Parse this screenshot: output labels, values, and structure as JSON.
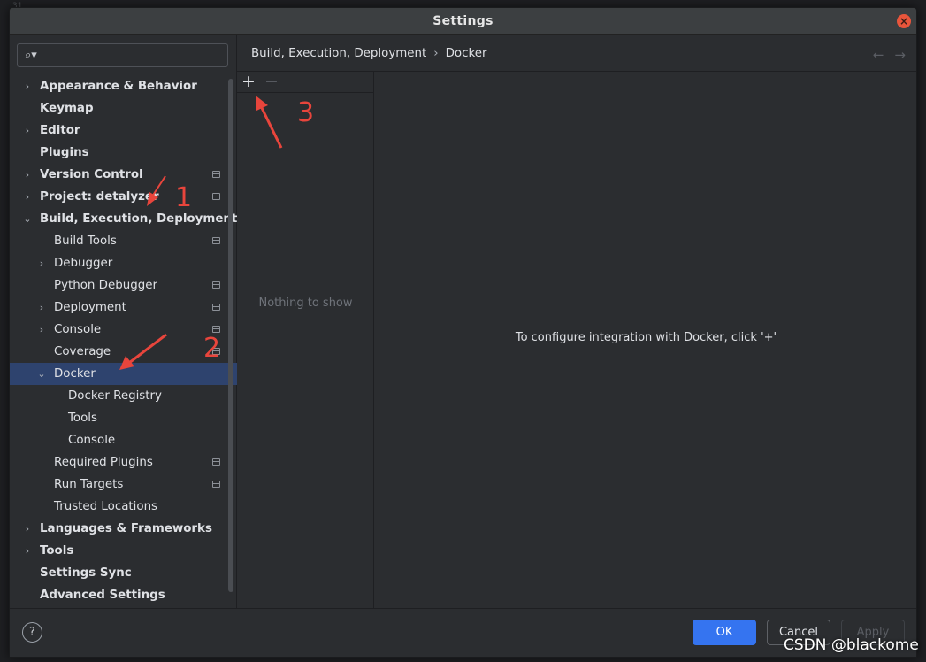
{
  "dialog": {
    "title": "Settings"
  },
  "search": {
    "placeholder": ""
  },
  "tree": [
    {
      "label": "Appearance & Behavior",
      "level": 0,
      "arrow": "›",
      "project_icon": false
    },
    {
      "label": "Keymap",
      "level": 0,
      "arrow": "",
      "project_icon": false
    },
    {
      "label": "Editor",
      "level": 0,
      "arrow": "›",
      "project_icon": false
    },
    {
      "label": "Plugins",
      "level": 0,
      "arrow": "",
      "project_icon": false
    },
    {
      "label": "Version Control",
      "level": 0,
      "arrow": "›",
      "project_icon": true
    },
    {
      "label": "Project: detalyzer",
      "level": 0,
      "arrow": "›",
      "project_icon": true
    },
    {
      "label": "Build, Execution, Deployment",
      "level": 0,
      "arrow": "⌄",
      "project_icon": false
    },
    {
      "label": "Build Tools",
      "level": 1,
      "arrow": "",
      "project_icon": true
    },
    {
      "label": "Debugger",
      "level": 1,
      "arrow": "›",
      "project_icon": false
    },
    {
      "label": "Python Debugger",
      "level": 1,
      "arrow": "",
      "project_icon": true
    },
    {
      "label": "Deployment",
      "level": 1,
      "arrow": "›",
      "project_icon": true
    },
    {
      "label": "Console",
      "level": 1,
      "arrow": "›",
      "project_icon": true
    },
    {
      "label": "Coverage",
      "level": 1,
      "arrow": "",
      "project_icon": true
    },
    {
      "label": "Docker",
      "level": 1,
      "arrow": "⌄",
      "project_icon": false,
      "selected": true
    },
    {
      "label": "Docker Registry",
      "level": 2,
      "arrow": "",
      "project_icon": false
    },
    {
      "label": "Tools",
      "level": 2,
      "arrow": "",
      "project_icon": false
    },
    {
      "label": "Console",
      "level": 2,
      "arrow": "",
      "project_icon": false
    },
    {
      "label": "Required Plugins",
      "level": 1,
      "arrow": "",
      "project_icon": true
    },
    {
      "label": "Run Targets",
      "level": 1,
      "arrow": "",
      "project_icon": true
    },
    {
      "label": "Trusted Locations",
      "level": 1,
      "arrow": "",
      "project_icon": false
    },
    {
      "label": "Languages & Frameworks",
      "level": 0,
      "arrow": "›",
      "project_icon": false
    },
    {
      "label": "Tools",
      "level": 0,
      "arrow": "›",
      "project_icon": false
    },
    {
      "label": "Settings Sync",
      "level": 0,
      "arrow": "",
      "project_icon": false
    },
    {
      "label": "Advanced Settings",
      "level": 0,
      "arrow": "",
      "project_icon": false
    }
  ],
  "breadcrumb": {
    "parent": "Build, Execution, Deployment",
    "sep": "›",
    "current": "Docker"
  },
  "list": {
    "add_icon": "+",
    "remove_icon": "−",
    "empty_text": "Nothing to show"
  },
  "detail": {
    "message": "To configure integration with Docker, click '+'"
  },
  "footer": {
    "help": "?",
    "ok": "OK",
    "cancel": "Cancel",
    "apply": "Apply"
  },
  "annotations": {
    "one": "1",
    "two": "2",
    "three": "3"
  },
  "watermark": "CSDN @blackome",
  "colors": {
    "accent": "#3574f0",
    "selection": "#2e436e",
    "annotation": "#e8453c",
    "background": "#2b2d30"
  }
}
